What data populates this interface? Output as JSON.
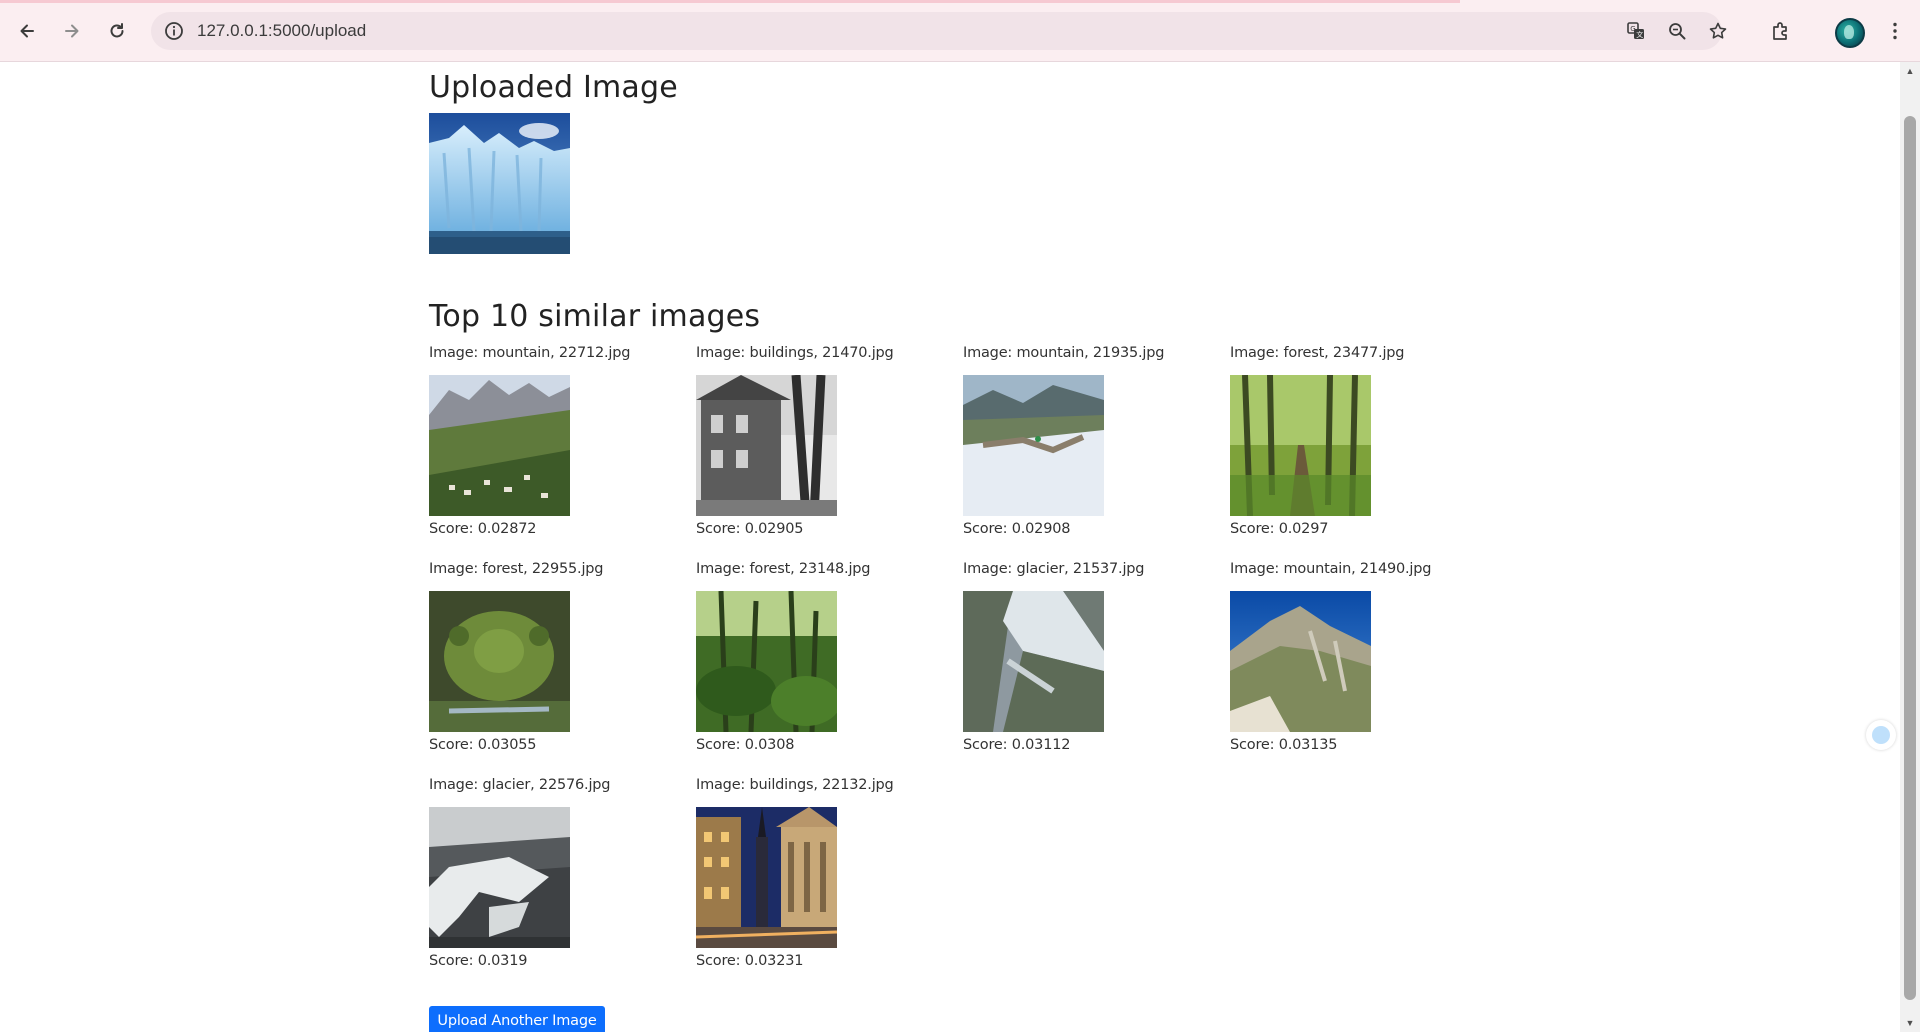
{
  "browser": {
    "url": "127.0.0.1:5000/upload",
    "icons": {
      "back": "back-arrow-icon",
      "forward": "forward-arrow-icon",
      "reload": "reload-icon",
      "site_info": "site-info-icon",
      "translate": "translate-icon",
      "zoom": "zoom-icon",
      "bookmark": "star-icon",
      "extensions": "puzzle-icon",
      "menu": "kebab-menu-icon"
    }
  },
  "page": {
    "uploaded_title": "Uploaded Image",
    "uploaded_image": "glacier-ice-wall",
    "results_title": "Top 10 similar images",
    "results": [
      {
        "name": "Image: mountain, 22712.jpg",
        "score": "Score: 0.02872",
        "scene": "mountain-village"
      },
      {
        "name": "Image: buildings, 21470.jpg",
        "score": "Score: 0.02905",
        "scene": "stone-house-bw"
      },
      {
        "name": "Image: mountain, 21935.jpg",
        "score": "Score: 0.02908",
        "scene": "snowy-slope"
      },
      {
        "name": "Image: forest, 23477.jpg",
        "score": "Score: 0.0297",
        "scene": "forest-path"
      },
      {
        "name": "Image: forest, 22955.jpg",
        "score": "Score: 0.03055",
        "scene": "mossy-stone"
      },
      {
        "name": "Image: forest, 23148.jpg",
        "score": "Score: 0.0308",
        "scene": "dense-forest"
      },
      {
        "name": "Image: glacier, 21537.jpg",
        "score": "Score: 0.03112",
        "scene": "glacier-valley"
      },
      {
        "name": "Image: mountain, 21490.jpg",
        "score": "Score: 0.03135",
        "scene": "mountain-ridge"
      },
      {
        "name": "Image: glacier, 22576.jpg",
        "score": "Score: 0.0319",
        "scene": "snowy-cliffs"
      },
      {
        "name": "Image: buildings, 22132.jpg",
        "score": "Score: 0.03231",
        "scene": "city-street-night"
      }
    ],
    "upload_button": "Upload Another Image"
  },
  "colors": {
    "chrome_bg": "#fbeef1",
    "omnibox_bg": "#f1e3e8",
    "button_blue": "#0d6efd"
  }
}
